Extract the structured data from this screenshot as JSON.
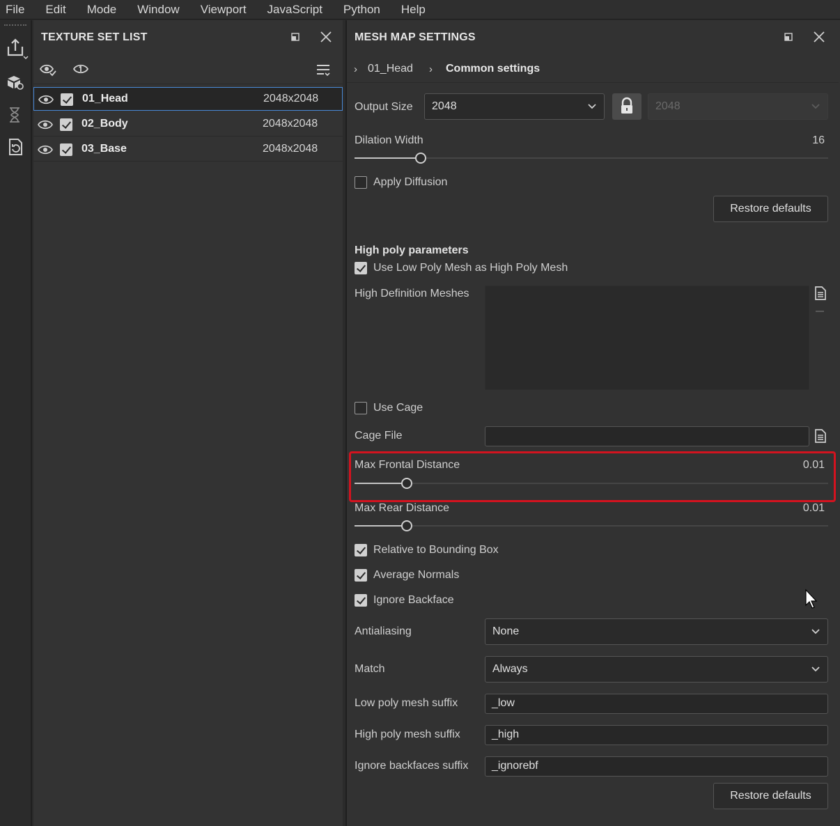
{
  "menu": [
    "File",
    "Edit",
    "Mode",
    "Window",
    "Viewport",
    "JavaScript",
    "Python",
    "Help"
  ],
  "texture_set_list": {
    "title": "TEXTURE SET LIST",
    "rows": [
      {
        "name": "01_Head",
        "size": "2048x2048",
        "visible": true,
        "checked": true,
        "selected": true
      },
      {
        "name": "02_Body",
        "size": "2048x2048",
        "visible": true,
        "checked": true,
        "selected": false
      },
      {
        "name": "03_Base",
        "size": "2048x2048",
        "visible": true,
        "checked": true,
        "selected": false
      }
    ]
  },
  "mesh_map_settings": {
    "title": "MESH MAP SETTINGS",
    "breadcrumb": [
      "01_Head",
      "Common settings"
    ],
    "output_size": {
      "label": "Output Size",
      "value": "2048",
      "locked_value": "2048"
    },
    "dilation_width": {
      "label": "Dilation Width",
      "value": "16",
      "fraction": 0.14
    },
    "apply_diffusion": {
      "label": "Apply Diffusion",
      "checked": false
    },
    "restore_defaults": "Restore defaults",
    "high_poly_section": "High poly parameters",
    "use_low_poly": {
      "label": "Use Low Poly Mesh as High Poly Mesh",
      "checked": true
    },
    "high_def_meshes": {
      "label": "High Definition Meshes"
    },
    "use_cage": {
      "label": "Use Cage",
      "checked": false
    },
    "cage_file": {
      "label": "Cage File",
      "value": ""
    },
    "max_frontal_distance": {
      "label": "Max Frontal Distance",
      "value": "0.01",
      "fraction": 0.11
    },
    "max_rear_distance": {
      "label": "Max Rear Distance",
      "value": "0.01",
      "fraction": 0.11
    },
    "relative_bbox": {
      "label": "Relative to Bounding Box",
      "checked": true
    },
    "average_normals": {
      "label": "Average Normals",
      "checked": true
    },
    "ignore_backface": {
      "label": "Ignore Backface",
      "checked": true
    },
    "antialiasing": {
      "label": "Antialiasing",
      "value": "None"
    },
    "match": {
      "label": "Match",
      "value": "Always"
    },
    "low_suffix": {
      "label": "Low poly mesh suffix",
      "value": "_low"
    },
    "high_suffix": {
      "label": "High poly mesh suffix",
      "value": "_high"
    },
    "ignore_suffix": {
      "label": "Ignore backfaces suffix",
      "value": "_ignorebf"
    },
    "restore_defaults_2": "Restore defaults"
  },
  "colors": {
    "highlight": "#d3131f",
    "selection": "#4a8ad8"
  }
}
